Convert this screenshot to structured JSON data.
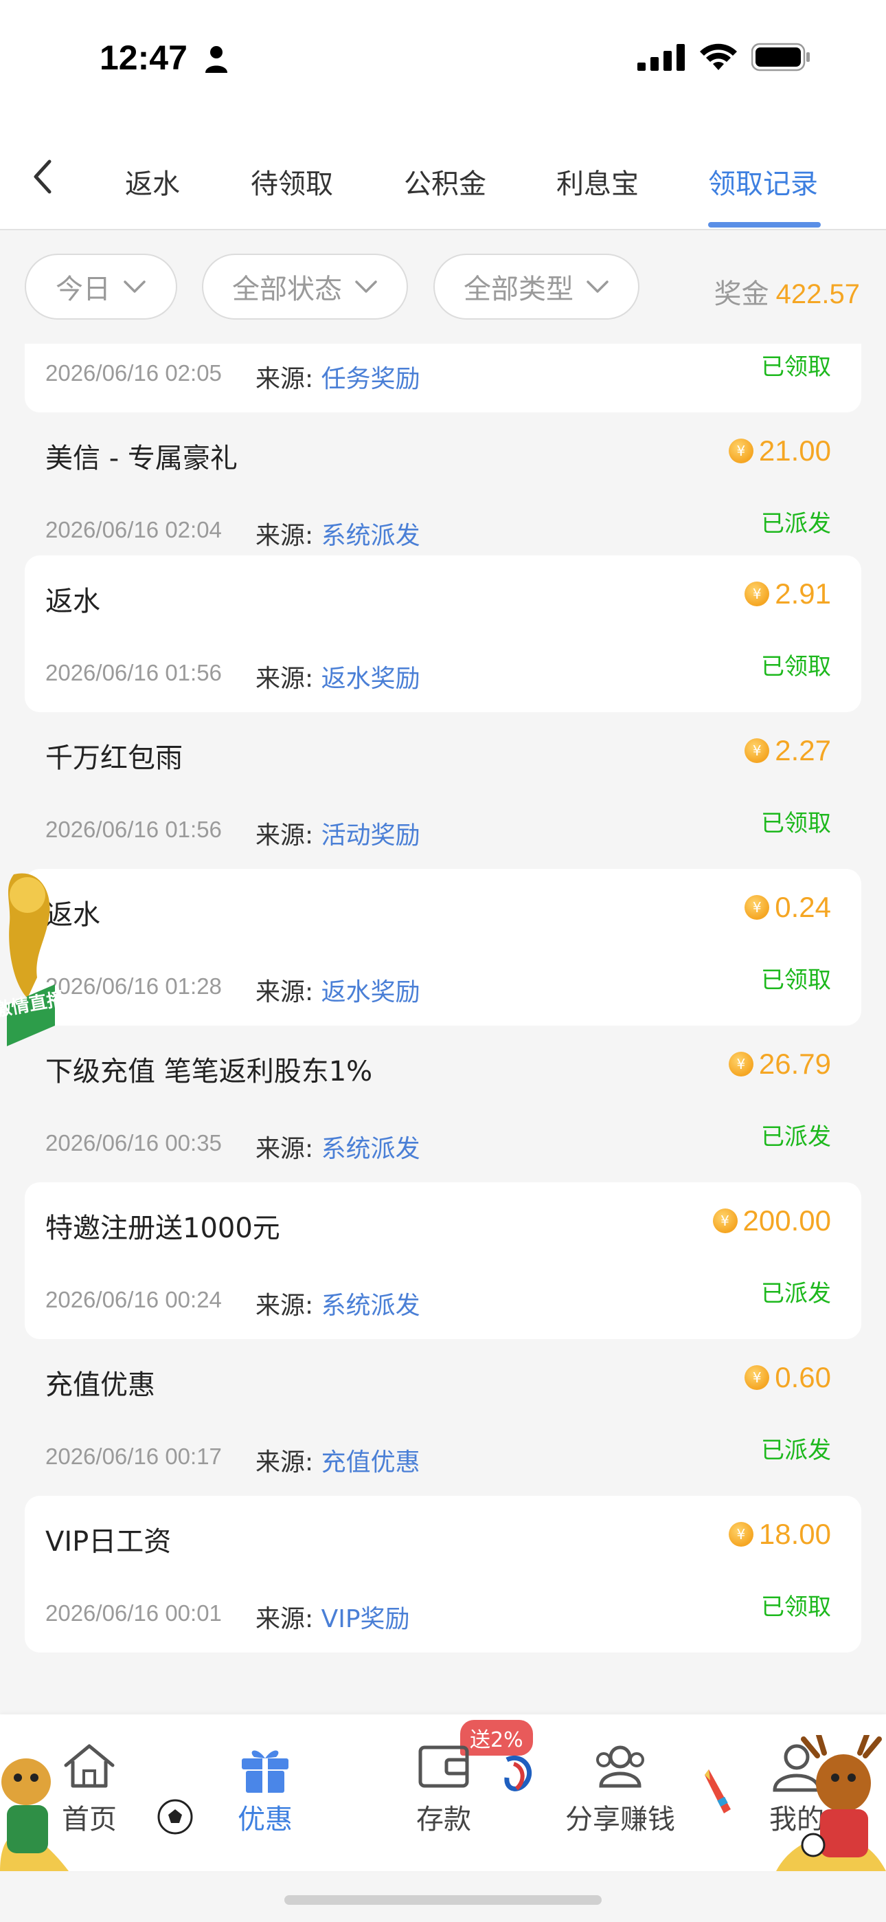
{
  "status_bar": {
    "time": "12:47"
  },
  "nav": {
    "tabs": [
      "返水",
      "待领取",
      "公积金",
      "利息宝",
      "领取记录"
    ],
    "active_index": 4
  },
  "filters": {
    "date": "今日",
    "status": "全部状态",
    "type": "全部类型",
    "bonus_label": "奖金",
    "bonus_value": "422.57"
  },
  "records": [
    {
      "title": "",
      "amount": "",
      "status": "已领取",
      "date": "2026/06/16 02:05",
      "source_label": "来源:",
      "source": "任务奖励"
    },
    {
      "title": "美信 - 专属豪礼",
      "amount": "21.00",
      "status": "已派发",
      "date": "2026/06/16 02:04",
      "source_label": "来源:",
      "source": "系统派发"
    },
    {
      "title": "返水",
      "amount": "2.91",
      "status": "已领取",
      "date": "2026/06/16 01:56",
      "source_label": "来源:",
      "source": "返水奖励"
    },
    {
      "title": "千万红包雨",
      "amount": "2.27",
      "status": "已领取",
      "date": "2026/06/16 01:56",
      "source_label": "来源:",
      "source": "活动奖励"
    },
    {
      "title": "返水",
      "amount": "0.24",
      "status": "已领取",
      "date": "2026/06/16 01:28",
      "source_label": "来源:",
      "source": "返水奖励"
    },
    {
      "title": "下级充值 笔笔返利股东1%",
      "amount": "26.79",
      "status": "已派发",
      "date": "2026/06/16 00:35",
      "source_label": "来源:",
      "source": "系统派发"
    },
    {
      "title": "特邀注册送1000元",
      "amount": "200.00",
      "status": "已派发",
      "date": "2026/06/16 00:24",
      "source_label": "来源:",
      "source": "系统派发"
    },
    {
      "title": "充值优惠",
      "amount": "0.60",
      "status": "已派发",
      "date": "2026/06/16 00:17",
      "source_label": "来源:",
      "source": "充值优惠"
    },
    {
      "title": "VIP日工资",
      "amount": "18.00",
      "status": "已领取",
      "date": "2026/06/16 00:01",
      "source_label": "来源:",
      "source": "VIP奖励"
    }
  ],
  "float_badge": {
    "text": "激情直播"
  },
  "tabbar": {
    "items": [
      "首页",
      "优惠",
      "存款",
      "分享赚钱",
      "我的"
    ],
    "active_index": 1,
    "promo_badge": "送2%"
  },
  "colors": {
    "accent": "#3d7fe0",
    "amount": "#f5a623",
    "status_green": "#1db81d",
    "source_blue": "#4a7fd6"
  }
}
